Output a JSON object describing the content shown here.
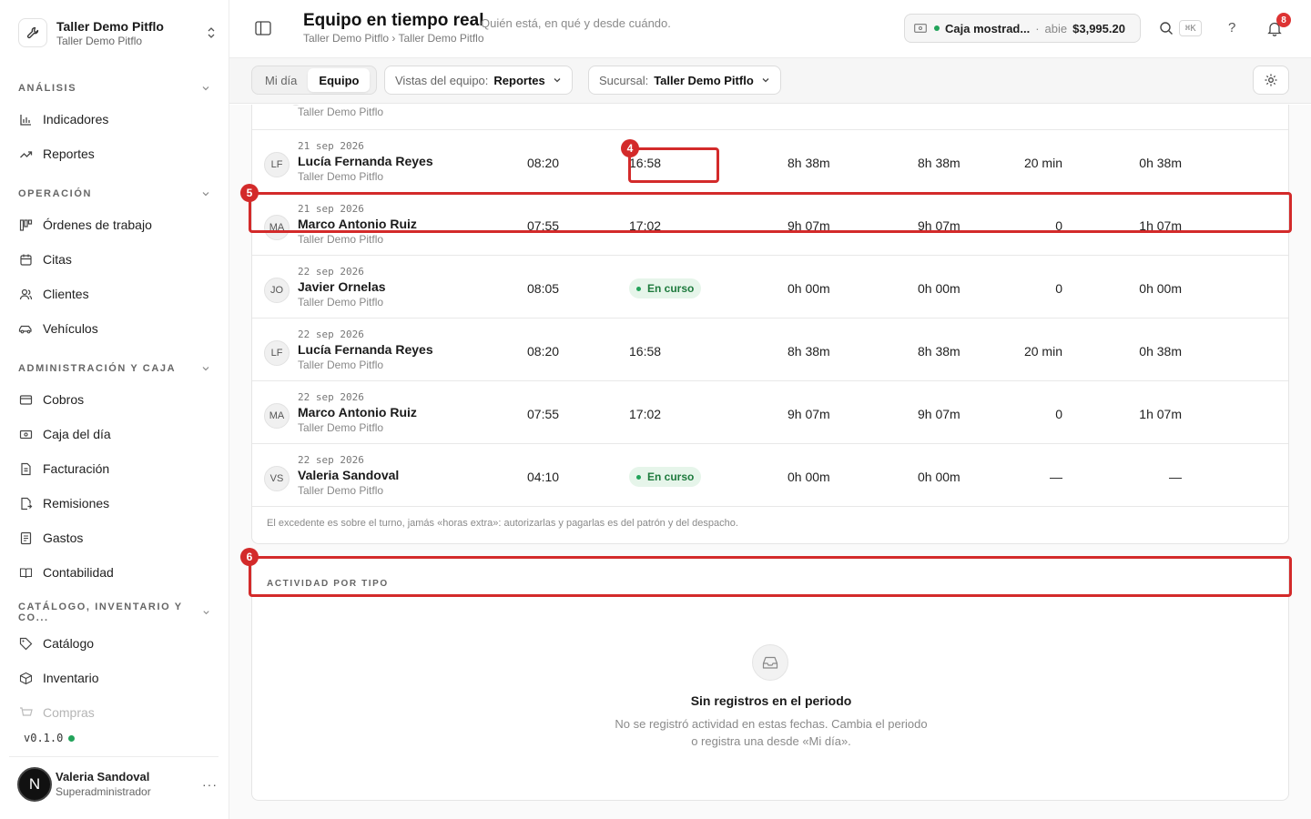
{
  "workspace": {
    "name": "Taller Demo Pitflo",
    "sub": "Taller Demo Pitflo"
  },
  "sidebar": {
    "sections": [
      {
        "title": "ANÁLISIS",
        "items": [
          {
            "label": "Indicadores",
            "icon": "bar-chart-icon"
          },
          {
            "label": "Reportes",
            "icon": "trend-up-icon"
          }
        ]
      },
      {
        "title": "OPERACIÓN",
        "items": [
          {
            "label": "Órdenes de trabajo",
            "icon": "kanban-icon"
          },
          {
            "label": "Citas",
            "icon": "calendar-icon"
          },
          {
            "label": "Clientes",
            "icon": "users-icon"
          },
          {
            "label": "Vehículos",
            "icon": "car-icon"
          }
        ]
      },
      {
        "title": "ADMINISTRACIÓN Y CAJA",
        "items": [
          {
            "label": "Cobros",
            "icon": "wallet-icon"
          },
          {
            "label": "Caja del día",
            "icon": "cash-icon"
          },
          {
            "label": "Facturación",
            "icon": "file-icon"
          },
          {
            "label": "Remisiones",
            "icon": "file-arrow-icon"
          },
          {
            "label": "Gastos",
            "icon": "receipt-icon"
          },
          {
            "label": "Contabilidad",
            "icon": "book-icon"
          }
        ]
      },
      {
        "title": "CATÁLOGO, INVENTARIO Y CO...",
        "items": [
          {
            "label": "Catálogo",
            "icon": "tag-icon"
          },
          {
            "label": "Inventario",
            "icon": "box-icon"
          },
          {
            "label": "Compras",
            "icon": "cart-icon"
          }
        ]
      }
    ],
    "version": "v0.1.0",
    "user": {
      "initial": "N",
      "name": "Valeria Sandoval",
      "role": "Superadministrador",
      "menu": "···"
    }
  },
  "header": {
    "title": "Equipo en tiempo real",
    "subtitle": "Quién está, en qué y desde cuándo.",
    "breadcrumb": "Taller Demo Pitflo › Taller Demo Pitflo",
    "cash": {
      "name": "Caja mostrad...",
      "sep": "·",
      "status": "abie",
      "amount": "$3,995.20"
    },
    "shortcut": "⌘K",
    "help": "?",
    "notifications": "8"
  },
  "toolbar": {
    "tabs": [
      "Mi día",
      "Equipo"
    ],
    "views": {
      "label": "Vistas del equipo:",
      "value": "Reportes"
    },
    "branch": {
      "label": "Sucursal:",
      "value": "Taller Demo Pitflo"
    }
  },
  "table": {
    "partial_branch": "Taller Demo Pitflo",
    "rows": [
      {
        "initials": "LF",
        "date": "21 sep 2026",
        "name": "Lucía Fernanda Reyes",
        "branch": "Taller Demo Pitflo",
        "in": "08:20",
        "out": "16:58",
        "status": "",
        "worked": "8h 38m",
        "effective": "8h 38m",
        "pause": "20 min",
        "excess": "0h 38m"
      },
      {
        "initials": "MA",
        "date": "21 sep 2026",
        "name": "Marco Antonio Ruiz",
        "branch": "Taller Demo Pitflo",
        "in": "07:55",
        "out": "17:02",
        "status": "",
        "worked": "9h 07m",
        "effective": "9h 07m",
        "pause": "0",
        "excess": "1h 07m"
      },
      {
        "initials": "JO",
        "date": "22 sep 2026",
        "name": "Javier Ornelas",
        "branch": "Taller Demo Pitflo",
        "in": "08:05",
        "out": "",
        "status": "En curso",
        "worked": "0h 00m",
        "effective": "0h 00m",
        "pause": "0",
        "excess": "0h 00m"
      },
      {
        "initials": "LF",
        "date": "22 sep 2026",
        "name": "Lucía Fernanda Reyes",
        "branch": "Taller Demo Pitflo",
        "in": "08:20",
        "out": "16:58",
        "status": "",
        "worked": "8h 38m",
        "effective": "8h 38m",
        "pause": "20 min",
        "excess": "0h 38m"
      },
      {
        "initials": "MA",
        "date": "22 sep 2026",
        "name": "Marco Antonio Ruiz",
        "branch": "Taller Demo Pitflo",
        "in": "07:55",
        "out": "17:02",
        "status": "",
        "worked": "9h 07m",
        "effective": "9h 07m",
        "pause": "0",
        "excess": "1h 07m"
      },
      {
        "initials": "VS",
        "date": "22 sep 2026",
        "name": "Valeria Sandoval",
        "branch": "Taller Demo Pitflo",
        "in": "04:10",
        "out": "",
        "status": "En curso",
        "worked": "0h 00m",
        "effective": "0h 00m",
        "pause": "—",
        "excess": "—"
      }
    ],
    "footnote": "El excedente es sobre el turno, jamás «horas extra»: autorizarlas y pagarlas es del patrón y del despacho."
  },
  "activity": {
    "title": "ACTIVIDAD POR TIPO",
    "empty_title": "Sin registros en el periodo",
    "empty_desc_1": "No se registró actividad en estas fechas. Cambia el periodo",
    "empty_desc_2": "o registra una desde «Mi día»."
  },
  "annotations": [
    "4",
    "5",
    "6"
  ]
}
